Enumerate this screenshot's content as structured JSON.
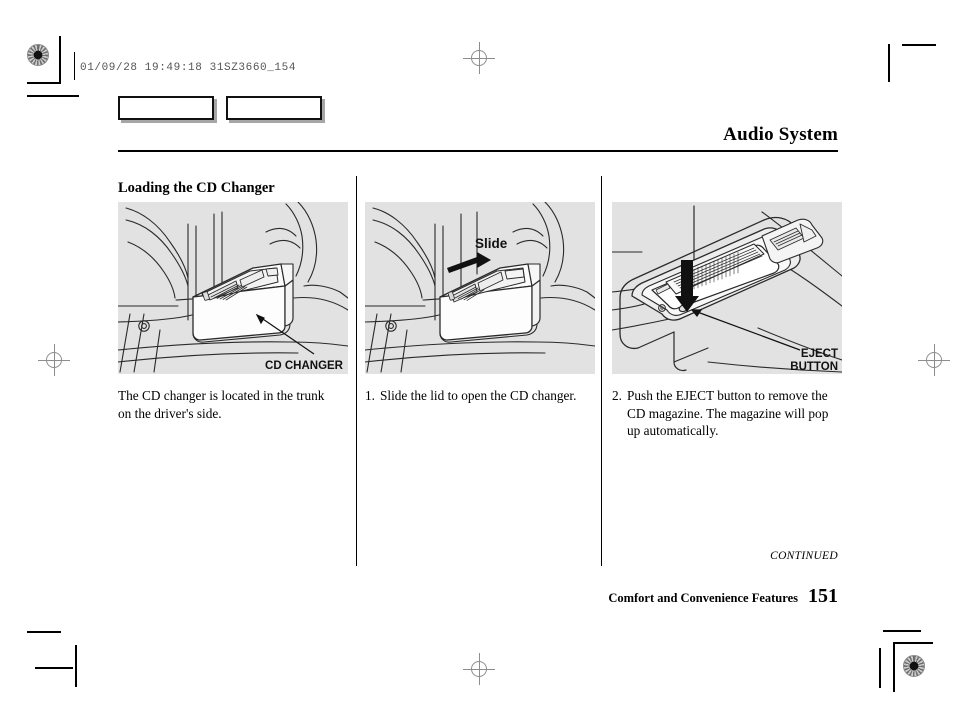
{
  "print_mark": {
    "code": "01/09/28 19:49:18 31SZ3660_154"
  },
  "header": {
    "title": "Audio System",
    "tabs": [
      {
        "label": ""
      },
      {
        "label": ""
      }
    ]
  },
  "content": {
    "section_heading": "Loading the CD Changer",
    "columns": [
      {
        "figure": {
          "name": "cd-changer-trunk-location",
          "callouts": [
            {
              "text": "CD CHANGER"
            }
          ]
        },
        "caption": {
          "number": "",
          "text": "The CD changer is located in the trunk on the driver's side."
        }
      },
      {
        "figure": {
          "name": "cd-changer-slide-lid",
          "callouts": [
            {
              "text": "Slide"
            }
          ]
        },
        "caption": {
          "number": "1.",
          "text": "Slide the lid to open the CD changer."
        }
      },
      {
        "figure": {
          "name": "cd-changer-eject-button",
          "callouts": [
            {
              "text": "EJECT"
            },
            {
              "text": "BUTTON"
            }
          ]
        },
        "caption": {
          "number": "2.",
          "text": "Push the EJECT button to remove the CD magazine. The magazine will pop up automatically."
        }
      }
    ]
  },
  "footer": {
    "continued": "CONTINUED",
    "section_label": "Comfort and Convenience Features",
    "page_number": "151"
  },
  "colors": {
    "page_background": "#ffffff",
    "figure_background": "#e2e2e2",
    "ink": "#000000",
    "print_code": "#555555",
    "registration": "#8d8d8d"
  }
}
